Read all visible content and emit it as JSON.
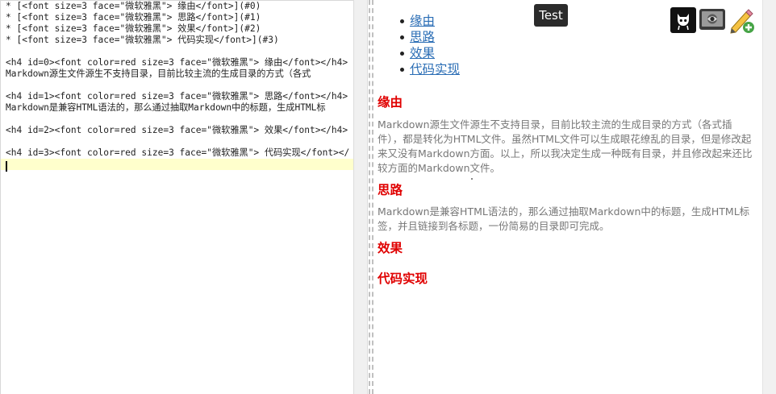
{
  "editor": {
    "lines": [
      "* [<font size=3 face=\"微软雅黑\"> 缘由</font>](#0)",
      "* [<font size=3 face=\"微软雅黑\"> 思路</font>](#1)",
      "* [<font size=3 face=\"微软雅黑\"> 效果</font>](#2)",
      "* [<font size=3 face=\"微软雅黑\"> 代码实现</font>](#3)",
      "",
      "<h4 id=0><font color=red size=3 face=\"微软雅黑\"> 缘由</font></h4>",
      "Markdown源生文件源生不支持目录，目前比较主流的生成目录的方式（各式",
      "",
      "<h4 id=1><font color=red size=3 face=\"微软雅黑\"> 思路</font></h4>",
      "Markdown是兼容HTML语法的，那么通过抽取Markdown中的标题，生成HTML标",
      "",
      "<h4 id=2><font color=red size=3 face=\"微软雅黑\"> 效果</font></h4>",
      "",
      "<h4 id=3><font color=red size=3 face=\"微软雅黑\"> 代码实现</font></",
      ""
    ]
  },
  "tooltip": {
    "text": "Test"
  },
  "toolbar": {
    "icons": [
      "github-icon",
      "preview-monitor-icon",
      "edit-pencil-icon"
    ]
  },
  "preview": {
    "toc": [
      "缘由",
      "思路",
      "效果",
      "代码实现"
    ],
    "sections": [
      {
        "heading": "缘由",
        "paragraph": "Markdown源生文件源生不支持目录，目前比较主流的生成目录的方式（各式插件），都是转化为HTML文件。虽然HTML文件可以生成眼花缭乱的目录，但是修改起来又没有Markdown方面。以上，所以我决定生成一种既有目录，并且修改起来还比较方面的Markdown文件。"
      },
      {
        "heading": "思路",
        "paragraph": "Markdown是兼容HTML语法的，那么通过抽取Markdown中的标题，生成HTML标签，并且链接到各标题，一份简易的目录即可完成。"
      },
      {
        "heading": "效果",
        "paragraph": ""
      },
      {
        "heading": "代码实现",
        "paragraph": ""
      }
    ]
  },
  "colors": {
    "heading": "#e00000",
    "link": "#2a6db5",
    "paragraph": "#777777",
    "active_line": "#ffffcc",
    "tooltip_bg": "#2b2b2b"
  }
}
